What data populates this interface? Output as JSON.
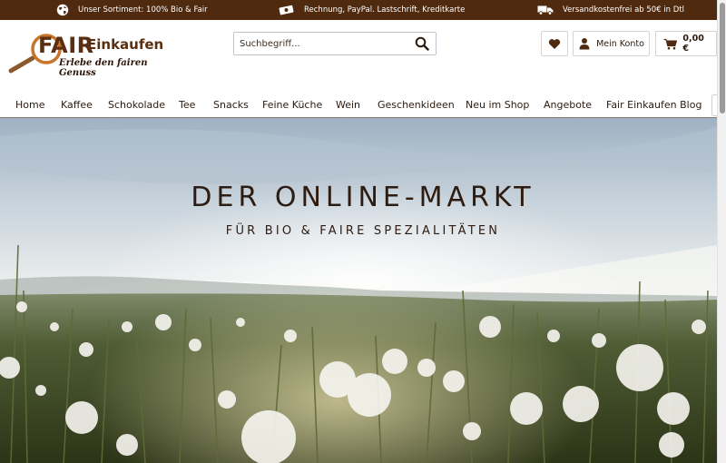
{
  "topbar": {
    "items": [
      {
        "icon": "globe-icon",
        "text": "Unser Sortiment: 100% Bio & Fair"
      },
      {
        "icon": "money-icon",
        "text": "Rechnung, PayPal. Lastschrift, Kreditkarte"
      },
      {
        "icon": "truck-icon",
        "text": "Versandkostenfrei ab 50€ in Dtl"
      }
    ]
  },
  "logo": {
    "fair": "FAIR",
    "einkaufen": "Einkaufen",
    "tagline": "Erlebe den fairen Genuss"
  },
  "search": {
    "placeholder": "Suchbegriff..."
  },
  "header": {
    "account_label": "Mein Konto",
    "cart_total": "0,00 €"
  },
  "nav": {
    "items": [
      "Home",
      "Kaffee",
      "Schokolade",
      "Tee",
      "Snacks",
      "Feine Küche",
      "Wein",
      "Geschenkideen",
      "Neu im Shop",
      "Angebote",
      "Fair Einkaufen Blog"
    ]
  },
  "hero": {
    "title": "DER ONLINE-MARKT",
    "subtitle": "FÜR BIO & FAIRE SPEZIALITÄTEN"
  },
  "colors": {
    "brand_brown": "#4f2a0f",
    "accent_orange": "#c8742a",
    "text_dark": "#2b1a0e"
  }
}
